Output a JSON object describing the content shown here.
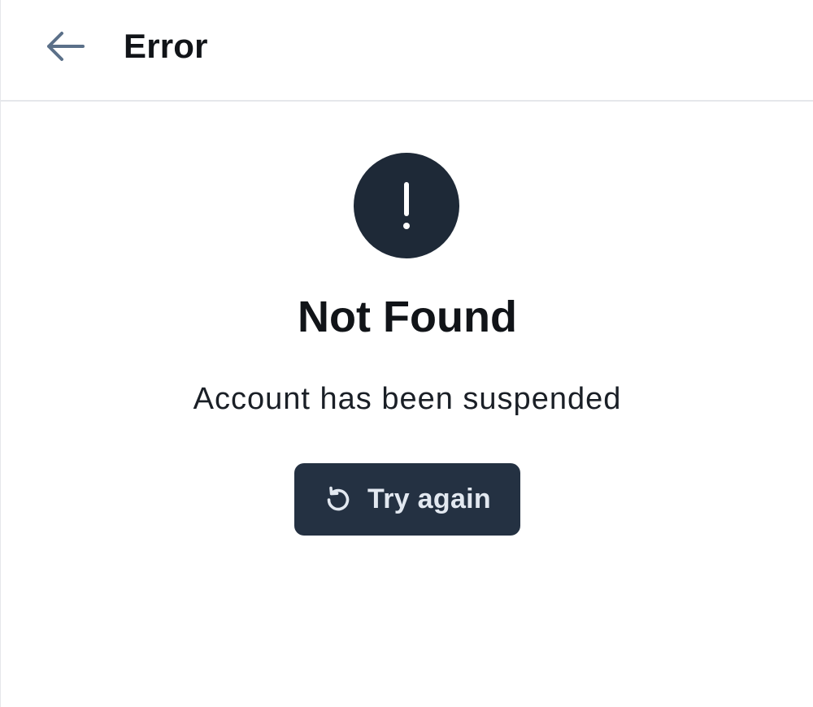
{
  "header": {
    "back_icon": "arrow-left-icon",
    "title": "Error"
  },
  "error": {
    "icon": "exclamation-icon",
    "title": "Not Found",
    "message": "Account has been suspended"
  },
  "retry": {
    "icon": "refresh-icon",
    "label": "Try again"
  },
  "colors": {
    "background": "#ffffff",
    "icon_circle": "#1e2937",
    "button_bg": "#243142",
    "button_text": "#e2e8f0",
    "back_arrow": "#5b7089",
    "text": "#111418"
  }
}
